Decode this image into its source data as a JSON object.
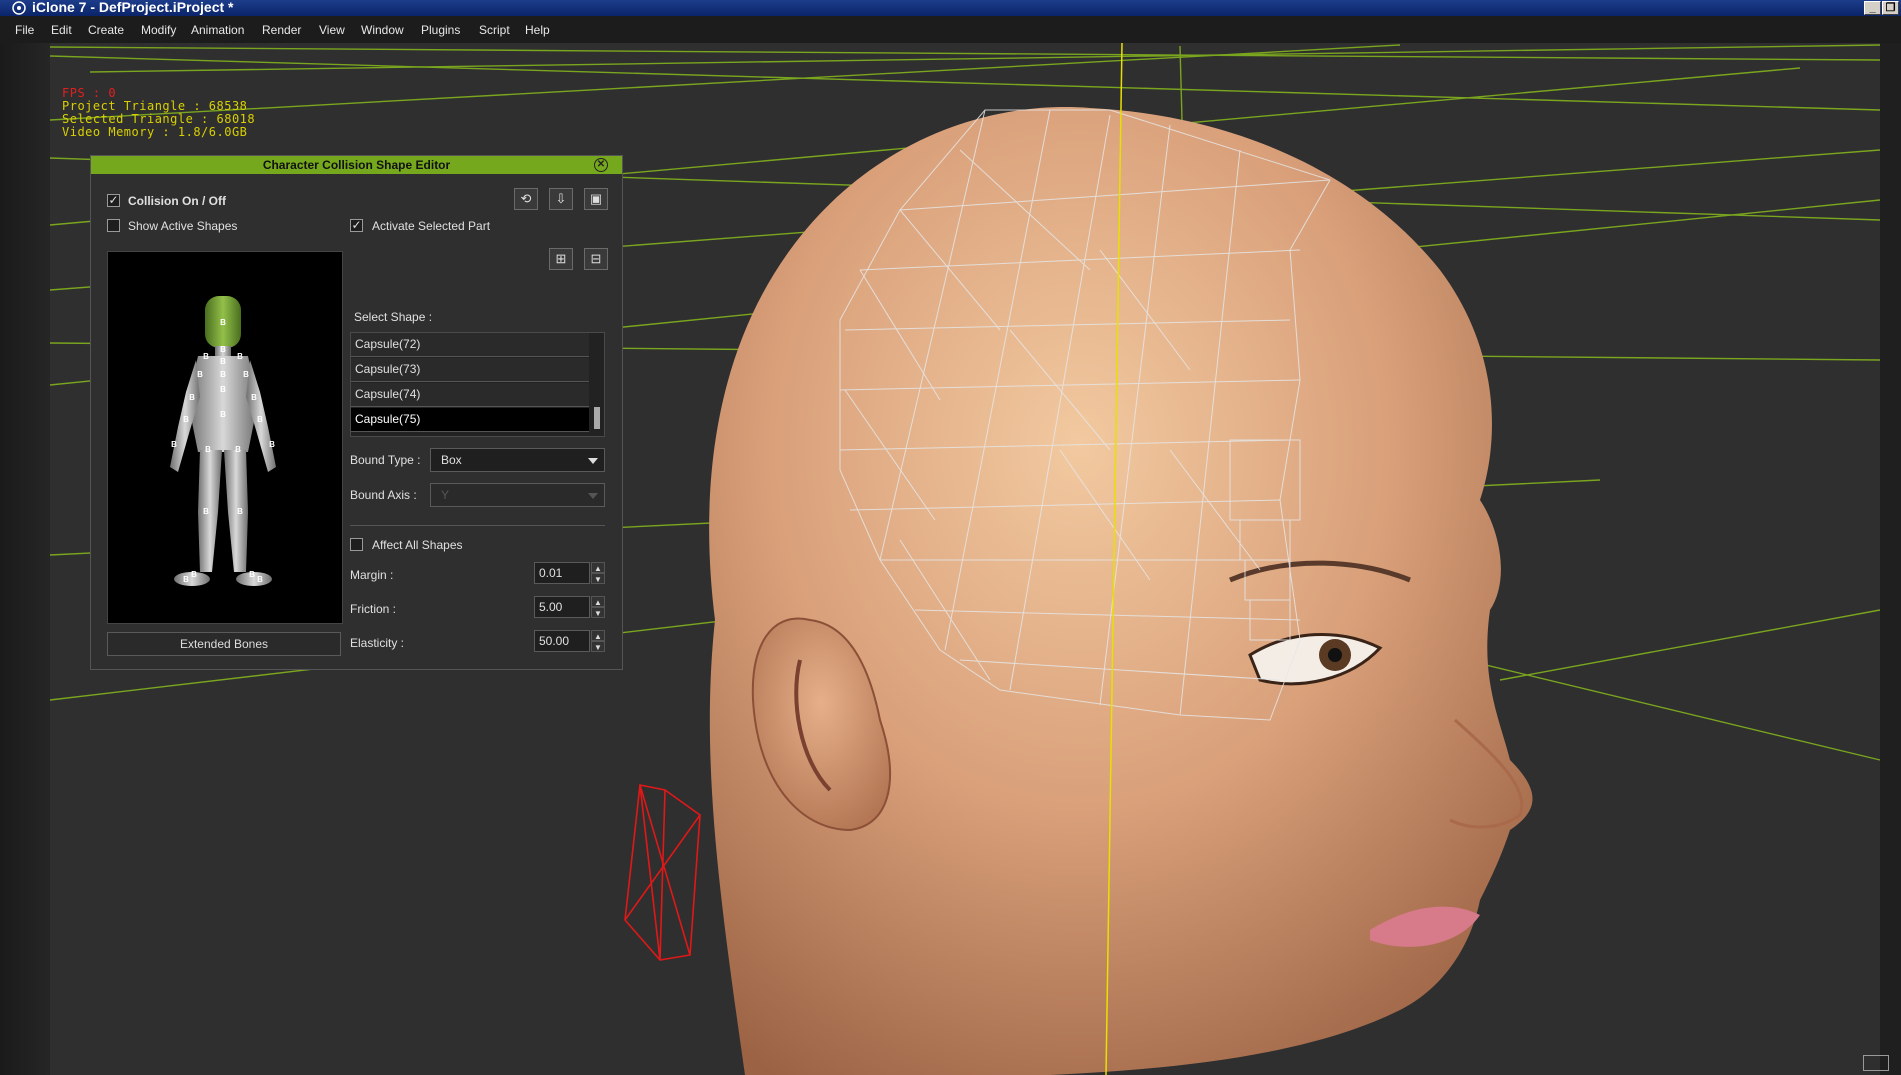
{
  "window": {
    "title": "iClone 7 - DefProject.iProject *",
    "controls": [
      "_",
      "❐"
    ]
  },
  "menu": [
    "File",
    "Edit",
    "Create",
    "Modify",
    "Animation",
    "Render",
    "View",
    "Window",
    "Plugins",
    "Script",
    "Help"
  ],
  "stats": {
    "fps": "FPS : 0",
    "project_triangle": "Project Triangle : 68538",
    "selected_triangle": "Selected Triangle : 68018",
    "video_memory": "Video Memory : 1.8/6.0GB"
  },
  "panel": {
    "title": "Character Collision Shape Editor",
    "collision_label": "Collision On / Off",
    "collision_checked": true,
    "show_active_label": "Show Active Shapes",
    "show_active_checked": false,
    "activate_label": "Activate Selected Part",
    "activate_checked": true,
    "select_shape_label": "Select Shape :",
    "shapes": [
      "Capsule(72)",
      "Capsule(73)",
      "Capsule(74)",
      "Capsule(75)"
    ],
    "selected_shape": "Capsule(75)",
    "bound_type_label": "Bound Type :",
    "bound_type_value": "Box",
    "bound_axis_label": "Bound Axis :",
    "bound_axis_value": "Y",
    "affect_all_label": "Affect All Shapes",
    "affect_all_checked": false,
    "margin_label": "Margin :",
    "margin_value": "0.01",
    "friction_label": "Friction :",
    "friction_value": "5.00",
    "elasticity_label": "Elasticity :",
    "elasticity_value": "50.00",
    "extended_bones_label": "Extended Bones",
    "bone_marker": "B",
    "header_color": "#76a81d"
  }
}
